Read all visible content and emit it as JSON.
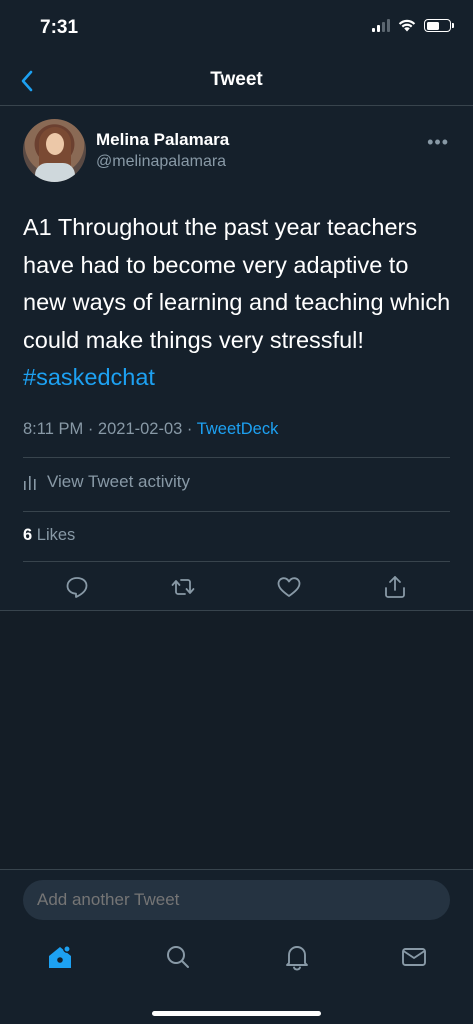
{
  "status_bar": {
    "time": "7:31"
  },
  "header": {
    "title": "Tweet",
    "back_icon": "chevron-left-icon"
  },
  "tweet": {
    "author": {
      "name": "Melina Palamara",
      "handle": "@melinapalamara"
    },
    "text_main": "A1 Throughout the past year teachers have had to become very adaptive to new ways of learning and teaching which could make things very stressful! ",
    "hashtag": "#saskedchat",
    "time": "8:11 PM",
    "separator": "·",
    "date": "2021-02-03",
    "source": "TweetDeck",
    "activity_label": "View Tweet activity",
    "likes_count": "6",
    "likes_label": "Likes"
  },
  "actions": [
    "reply-icon",
    "retweet-icon",
    "like-icon",
    "share-icon"
  ],
  "compose": {
    "placeholder": "Add another Tweet"
  },
  "tab_bar": [
    "home-icon",
    "search-icon",
    "notifications-icon",
    "messages-icon"
  ],
  "colors": {
    "background": "#15202b",
    "accent": "#1da1f2",
    "secondary_text": "#8899a6",
    "divider": "#38444d"
  }
}
